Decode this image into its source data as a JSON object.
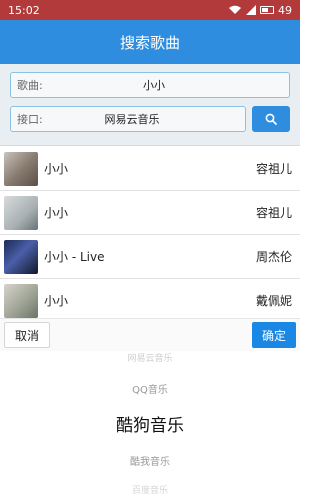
{
  "status_bar": {
    "time": "15:02",
    "battery_level": "49"
  },
  "header": {
    "title": "搜索歌曲"
  },
  "search": {
    "song_label": "歌曲:",
    "song_value": "小小",
    "api_label": "接口:",
    "api_value": "网易云音乐"
  },
  "songs": [
    {
      "title": "小小",
      "artist": "容祖儿"
    },
    {
      "title": "小小",
      "artist": "容祖儿"
    },
    {
      "title": "小小 - Live",
      "artist": "周杰伦"
    },
    {
      "title": "小小",
      "artist": "戴佩妮"
    }
  ],
  "picker": {
    "cancel_label": "取消",
    "confirm_label": "确定",
    "options": [
      "网易云音乐",
      "QQ音乐",
      "酷狗音乐",
      "酷我音乐",
      "百度音乐"
    ],
    "selected": "酷狗音乐"
  },
  "colors": {
    "accent": "#2f8de0",
    "status_bar": "#b33a3a",
    "confirm": "#1b87e5"
  }
}
